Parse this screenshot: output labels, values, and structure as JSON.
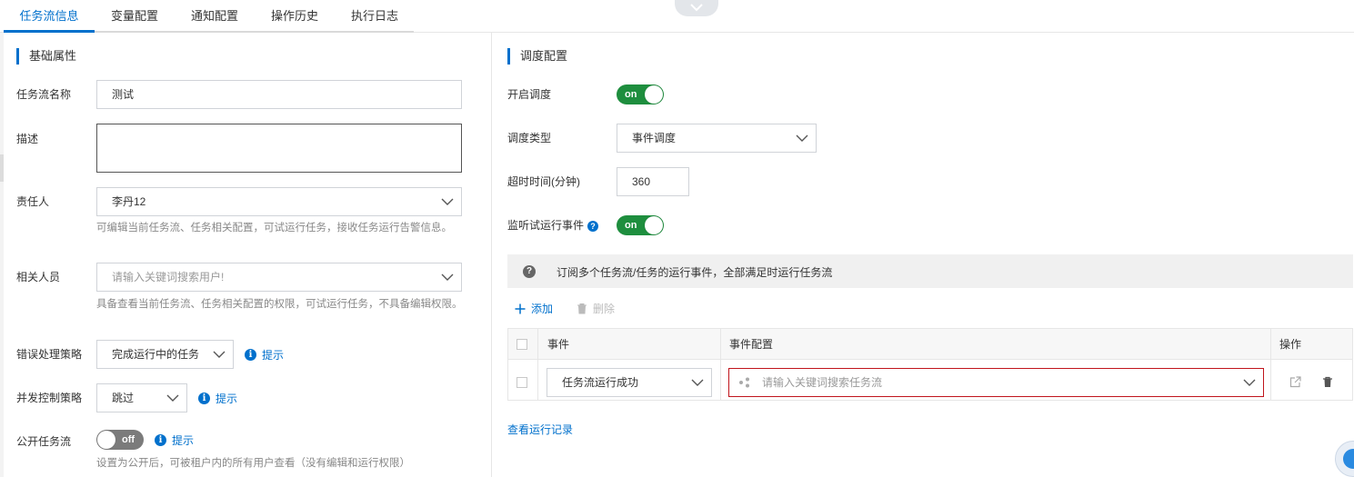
{
  "tabs": [
    {
      "label": "任务流信息",
      "active": true
    },
    {
      "label": "变量配置"
    },
    {
      "label": "通知配置"
    },
    {
      "label": "操作历史"
    },
    {
      "label": "执行日志"
    }
  ],
  "basic": {
    "section_title": "基础属性",
    "name": {
      "label": "任务流名称",
      "value": "测试"
    },
    "description": {
      "label": "描述",
      "value": ""
    },
    "owner": {
      "label": "责任人",
      "value": "李丹12",
      "hint": "可编辑当前任务流、任务相关配置，可试运行任务，接收任务运行告警信息。"
    },
    "related": {
      "label": "相关人员",
      "placeholder": "请输入关键词搜索用户!",
      "hint": "具备查看当前任务流、任务相关配置的权限，可试运行任务，不具备编辑权限。"
    },
    "error_policy": {
      "label": "错误处理策略",
      "value": "完成运行中的任务",
      "tip": "提示"
    },
    "concurrency": {
      "label": "并发控制策略",
      "value": "跳过",
      "tip": "提示"
    },
    "public": {
      "label": "公开任务流",
      "toggle": "off",
      "tip": "提示",
      "hint": "设置为公开后，可被租户内的所有用户查看（没有编辑和运行权限）"
    }
  },
  "schedule": {
    "section_title": "调度配置",
    "enable": {
      "label": "开启调度",
      "toggle": "on"
    },
    "type": {
      "label": "调度类型",
      "value": "事件调度"
    },
    "timeout": {
      "label": "超时时间(分钟)",
      "value": "360"
    },
    "listen": {
      "label": "监听试运行事件",
      "help": "?",
      "toggle": "on"
    },
    "notice": {
      "icon": "?",
      "text": "订阅多个任务流/任务的运行事件，全部满足时运行任务流"
    },
    "add_label": "添加",
    "delete_label": "删除",
    "table": {
      "headers": [
        "事件",
        "事件配置",
        "操作"
      ],
      "rows": [
        {
          "event": "任务流运行成功",
          "config_placeholder": "请输入关键词搜索任务流"
        }
      ]
    },
    "view_runs_link": "查看运行记录"
  },
  "colors": {
    "accent": "#0070cc",
    "toggle_on": "#1e8e3e",
    "toggle_off": "#7b7b7b",
    "error_border": "#c0141c"
  }
}
